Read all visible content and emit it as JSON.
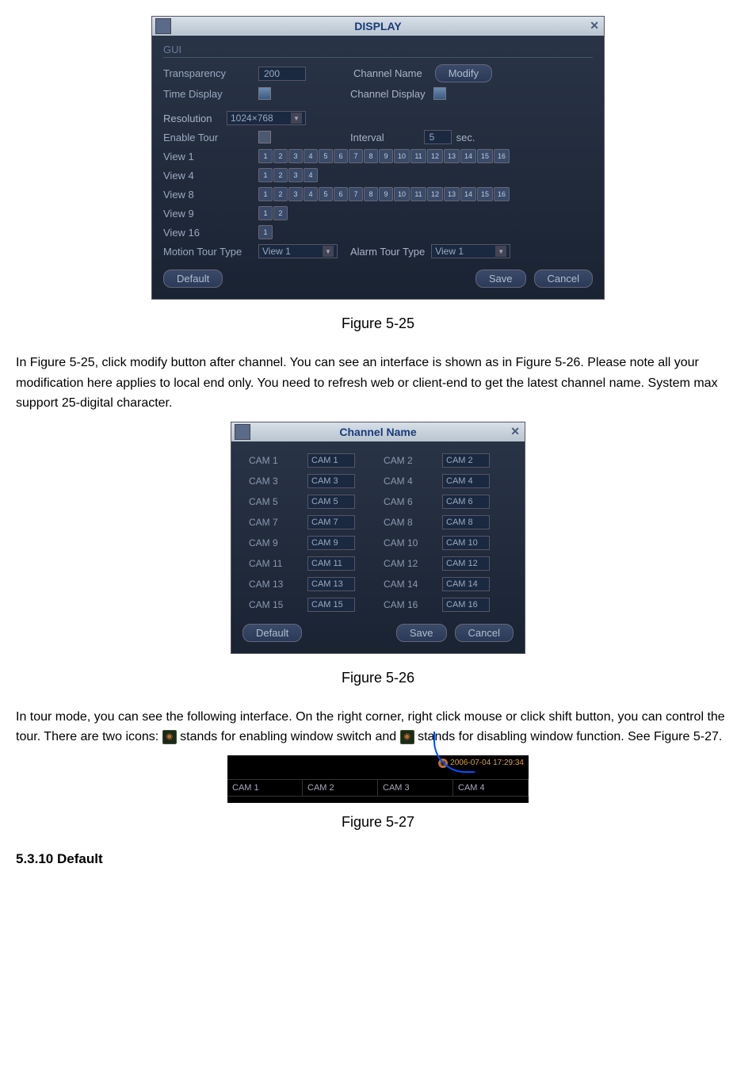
{
  "display_dialog": {
    "title": "DISPLAY",
    "section": "GUI",
    "transparency_label": "Transparency",
    "transparency_value": "200",
    "channel_name_label": "Channel Name",
    "modify_btn": "Modify",
    "time_display_label": "Time Display",
    "channel_display_label": "Channel Display",
    "resolution_label": "Resolution",
    "resolution_value": "1024×768",
    "enable_tour_label": "Enable Tour",
    "interval_label": "Interval",
    "interval_value": "5",
    "interval_unit": "sec.",
    "view1_label": "View 1",
    "view4_label": "View 4",
    "view8_label": "View 8",
    "view9_label": "View 9",
    "view16_label": "View 16",
    "motion_tour_label": "Motion Tour Type",
    "motion_tour_value": "View 1",
    "alarm_tour_label": "Alarm Tour Type",
    "alarm_tour_value": "View 1",
    "default_btn": "Default",
    "save_btn": "Save",
    "cancel_btn": "Cancel",
    "nums16": [
      "1",
      "2",
      "3",
      "4",
      "5",
      "6",
      "7",
      "8",
      "9",
      "10",
      "11",
      "12",
      "13",
      "14",
      "15",
      "16"
    ],
    "nums4": [
      "1",
      "2",
      "3",
      "4"
    ],
    "nums2": [
      "1",
      "2"
    ],
    "nums1": [
      "1"
    ]
  },
  "fig525": "Figure 5-25",
  "para1": "In Figure 5-25, click modify button after channel. You can see an interface is shown as in Figure 5-26. Please note all your modification here applies to local end only. You need to refresh web or client-end to get the latest channel name. System max support 25-digital character.",
  "channel_dialog": {
    "title": "Channel Name",
    "rows": [
      {
        "l1": "CAM 1",
        "v1": "CAM 1",
        "l2": "CAM 2",
        "v2": "CAM 2"
      },
      {
        "l1": "CAM 3",
        "v1": "CAM 3",
        "l2": "CAM 4",
        "v2": "CAM 4"
      },
      {
        "l1": "CAM 5",
        "v1": "CAM 5",
        "l2": "CAM 6",
        "v2": "CAM 6"
      },
      {
        "l1": "CAM 7",
        "v1": "CAM 7",
        "l2": "CAM 8",
        "v2": "CAM 8"
      },
      {
        "l1": "CAM 9",
        "v1": "CAM 9",
        "l2": "CAM 10",
        "v2": "CAM 10"
      },
      {
        "l1": "CAM 11",
        "v1": "CAM 11",
        "l2": "CAM 12",
        "v2": "CAM 12"
      },
      {
        "l1": "CAM 13",
        "v1": "CAM 13",
        "l2": "CAM 14",
        "v2": "CAM 14"
      },
      {
        "l1": "CAM 15",
        "v1": "CAM 15",
        "l2": "CAM 16",
        "v2": "CAM 16"
      }
    ],
    "default_btn": "Default",
    "save_btn": "Save",
    "cancel_btn": "Cancel"
  },
  "fig526": "Figure 5-26",
  "para2a": "In tour mode, you can see the following interface. On the right corner, right click mouse or click shift button, you can control the tour. There are two icons: ",
  "para2b": " stands for enabling window switch and ",
  "para2c": " stands for disabling window function. See Figure 5-27.",
  "tour": {
    "timestamp": "2006-07-04 17:29:34",
    "cells": [
      "CAM 1",
      "CAM 2",
      "CAM 3",
      "CAM 4"
    ]
  },
  "fig527": "Figure 5-27",
  "heading": "5.3.10 Default"
}
